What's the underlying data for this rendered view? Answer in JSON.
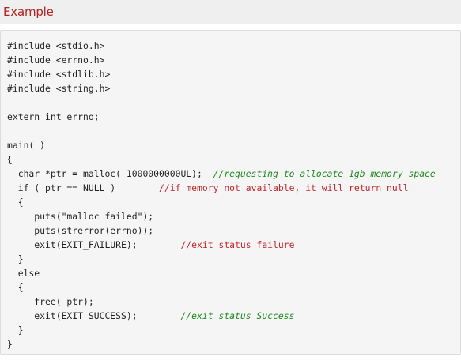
{
  "header": {
    "title": "Example"
  },
  "code": {
    "lines": [
      {
        "code": "#include <stdio.h>",
        "comment": "",
        "comment_style": ""
      },
      {
        "code": "#include <errno.h>",
        "comment": "",
        "comment_style": ""
      },
      {
        "code": "#include <stdlib.h>",
        "comment": "",
        "comment_style": ""
      },
      {
        "code": "#include <string.h>",
        "comment": "",
        "comment_style": ""
      },
      {
        "code": "",
        "comment": "",
        "comment_style": ""
      },
      {
        "code": "extern int errno;",
        "comment": "",
        "comment_style": ""
      },
      {
        "code": "",
        "comment": "",
        "comment_style": ""
      },
      {
        "code": "main( )",
        "comment": "",
        "comment_style": ""
      },
      {
        "code": "{",
        "comment": "",
        "comment_style": ""
      },
      {
        "code": "  char *ptr = malloc( 1000000000UL);  ",
        "comment": "//requesting to allocate 1gb memory space",
        "comment_style": "green"
      },
      {
        "code": "  if ( ptr == NULL )        ",
        "comment": "//if memory not available, it will return null",
        "comment_style": "red"
      },
      {
        "code": "  {",
        "comment": "",
        "comment_style": ""
      },
      {
        "code": "     puts(\"malloc failed\");",
        "comment": "",
        "comment_style": ""
      },
      {
        "code": "     puts(strerror(errno));",
        "comment": "",
        "comment_style": ""
      },
      {
        "code": "     exit(EXIT_FAILURE);        ",
        "comment": "//exit status failure",
        "comment_style": "red"
      },
      {
        "code": "  }",
        "comment": "",
        "comment_style": ""
      },
      {
        "code": "  else",
        "comment": "",
        "comment_style": ""
      },
      {
        "code": "  {",
        "comment": "",
        "comment_style": ""
      },
      {
        "code": "     free( ptr);",
        "comment": "",
        "comment_style": ""
      },
      {
        "code": "     exit(EXIT_SUCCESS);        ",
        "comment": "//exit status Success",
        "comment_style": "green"
      },
      {
        "code": "  }",
        "comment": "",
        "comment_style": ""
      },
      {
        "code": "}",
        "comment": "",
        "comment_style": ""
      }
    ]
  }
}
